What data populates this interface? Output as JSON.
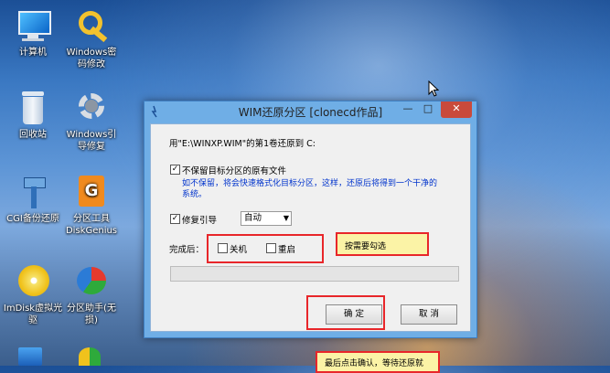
{
  "desktop": {
    "icons": [
      {
        "label": "计算机",
        "icon": "computer-icon"
      },
      {
        "label": "Windows密码修改",
        "icon": "key-icon"
      },
      {
        "label": "回收站",
        "icon": "recycle-bin-icon"
      },
      {
        "label": "Windows引导修复",
        "icon": "gear-icon"
      },
      {
        "label": "CGI备份还原",
        "icon": "hammer-icon"
      },
      {
        "label": "分区工具DiskGenius",
        "icon": "diskgenius-icon"
      },
      {
        "label": "ImDisk虚拟光驱",
        "icon": "disc-icon"
      },
      {
        "label": "分区助手(无损)",
        "icon": "partition-assistant-icon"
      }
    ]
  },
  "window": {
    "title": "WIM还原分区 [clonecd作品]",
    "controls": {
      "minimize": "—",
      "maximize": "□",
      "close": "✕"
    },
    "restore_text": "用\"E:\\WINXP.WIM\"的第1卷还原到 C:",
    "no_keep_label": "不保留目标分区的原有文件",
    "no_keep_checked": true,
    "no_keep_hint_line1": "如不保留，将会快速格式化目标分区，这样，还原后将得到一个干净的",
    "no_keep_hint_line2": "系统。",
    "fix_boot_label": "修复引导",
    "fix_boot_checked": true,
    "boot_mode_value": "自动",
    "after_label": "完成后：",
    "shutdown_label": "关机",
    "restart_label": "重启",
    "progress": 0,
    "ok_label": "确  定",
    "cancel_label": "取  消"
  },
  "annotations": {
    "callout_check": "按需要勾选",
    "callout_confirm": "最后点击确认，等待还原就"
  },
  "colors": {
    "highlight_red": "#e8262a",
    "callout_bg": "#fbf3a6",
    "hint_blue": "#0033cc"
  }
}
